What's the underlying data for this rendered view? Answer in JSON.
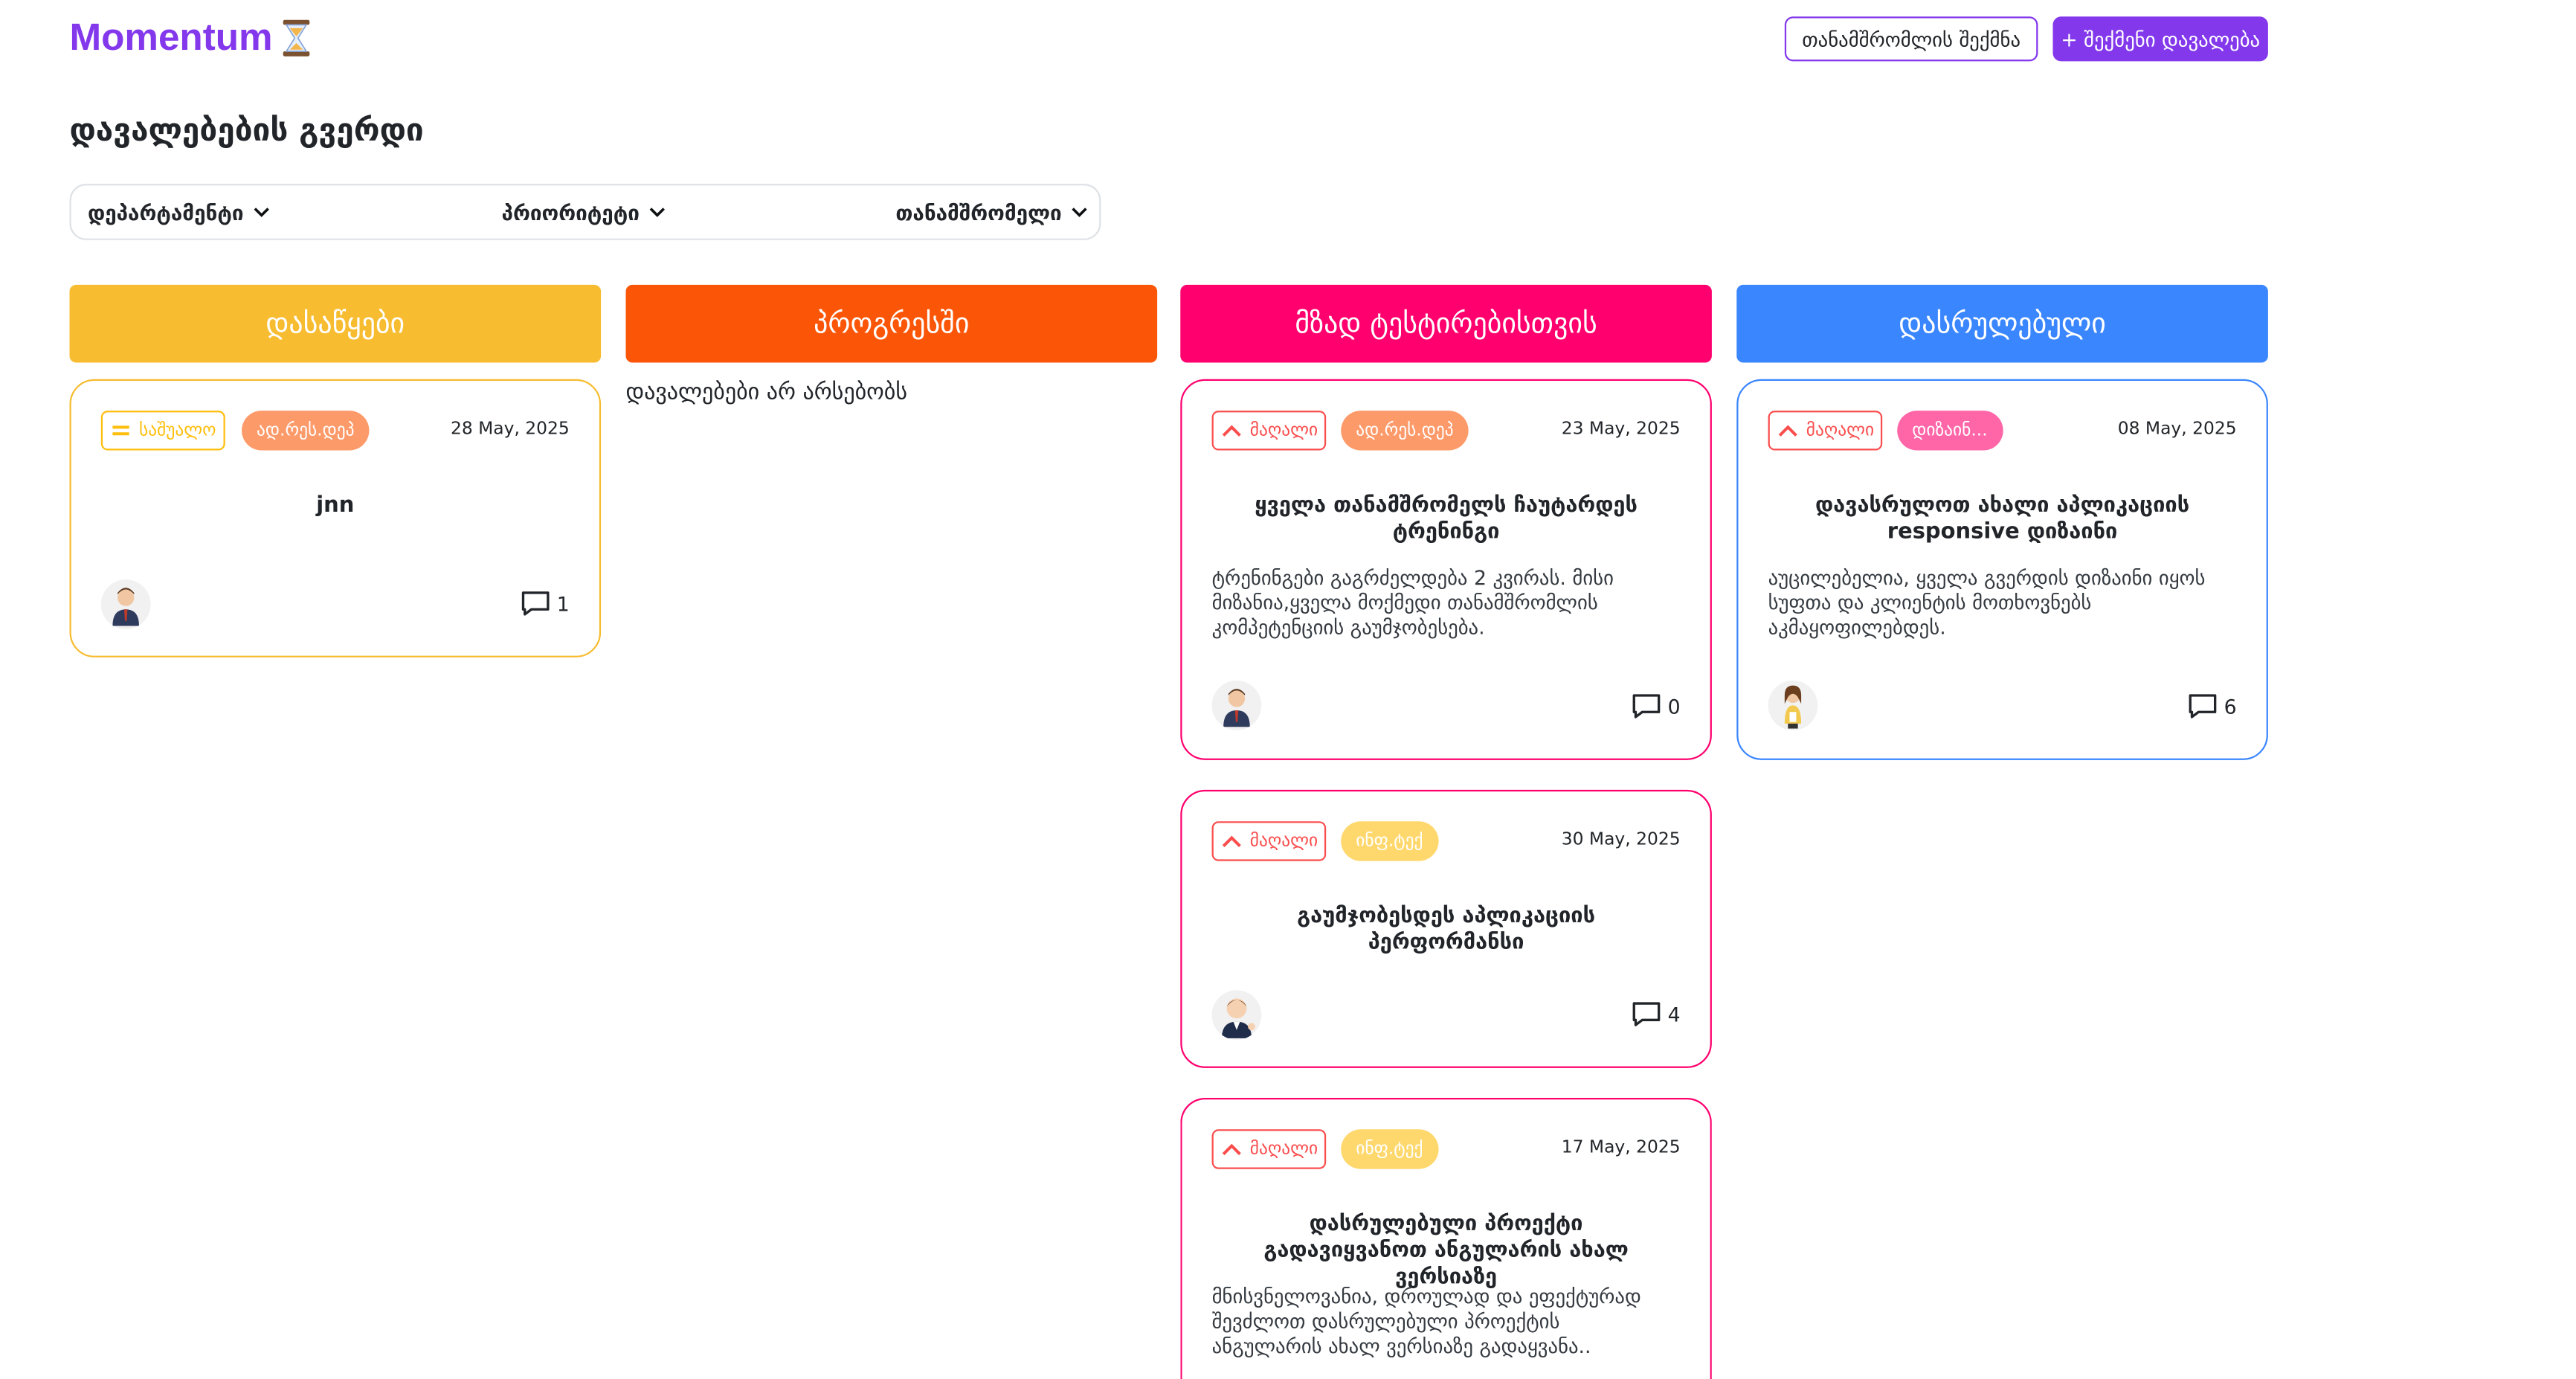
{
  "app": {
    "logo_text": "Momentum"
  },
  "header": {
    "create_employee": "თანამშრომლის შექმნა",
    "create_task": "+ შექმენი დავალება"
  },
  "page": {
    "title": "დავალებების გვერდი"
  },
  "filters": [
    {
      "label": "დეპარტამენტი"
    },
    {
      "label": "პრიორიტეტი"
    },
    {
      "label": "თანამშრომელი"
    }
  ],
  "columns": [
    {
      "title": "დასაწყები",
      "color": "#F7BC30"
    },
    {
      "title": "პროგრესში",
      "color": "#FB5607"
    },
    {
      "title": "მზად ტესტირებისთვის",
      "color": "#FF006E"
    },
    {
      "title": "დასრულებული",
      "color": "#3A86FF"
    }
  ],
  "empty_column_text": "დავალებები არ არსებობს",
  "cards": [
    {
      "priority": "საშუალო",
      "priority_icon": "equals-icon",
      "priority_color": "#FFBE0B",
      "department": "ად.რეს.დეპ",
      "department_color": "#FD9A6A",
      "date": "28 May, 2025",
      "title": "jnn",
      "description": "",
      "avatar": "male-avatar-suit",
      "comments": "1"
    },
    {
      "priority": "მაღალი",
      "priority_icon": "chevron-up-icon",
      "priority_color": "#FA4D4D",
      "department": "ად.რეს.დეპ",
      "department_color": "#FD9A6A",
      "date": "23 May, 2025",
      "title": "ყველა თანამშრომელს ჩაუტარდეს ტრენინგი",
      "description": "ტრენინგები გაგრძელდება 2 კვირას. მისი მიზანია,ყველა მოქმედი თანამშრომლის კომპეტენციის გაუმჯობესება.",
      "avatar": "male-avatar-suit",
      "comments": "0"
    },
    {
      "priority": "მაღალი",
      "priority_icon": "chevron-up-icon",
      "priority_color": "#FA4D4D",
      "department": "დიზაინ...",
      "department_color": "#FF66A8",
      "date": "08 May, 2025",
      "title": "დავასრულოთ ახალი აპლიკაციის responsive დიზაინი",
      "description": "აუცილებელია, ყველა გვერდის დიზაინი იყოს სუფთა და კლიენტის მოთხოვნებს აკმაყოფილებდეს.",
      "avatar": "female-avatar",
      "comments": "6"
    },
    {
      "priority": "მაღალი",
      "priority_icon": "chevron-up-icon",
      "priority_color": "#FA4D4D",
      "department": "ინფ.ტექ",
      "department_color": "#FFD86D",
      "date": "30 May, 2025",
      "title": "გაუმჯობესდეს აპლიკაციის პერფორმანსი",
      "description": "",
      "avatar": "male-avatar-cartoon",
      "comments": "4"
    },
    {
      "priority": "მაღალი",
      "priority_icon": "chevron-up-icon",
      "priority_color": "#FA4D4D",
      "department": "ინფ.ტექ",
      "department_color": "#FFD86D",
      "date": "17 May, 2025",
      "title": "დასრულებული პროექტი გადავიყვანოთ ანგულარის ახალ ვერსიაზე",
      "description": "მნისვნელოვანია, დროულად და ეფექტურად შევძლოთ დასრულებული პროექტის ანგულარის ახალ ვერსიაზე გადაყვანა..",
      "avatar": "",
      "comments": ""
    }
  ]
}
